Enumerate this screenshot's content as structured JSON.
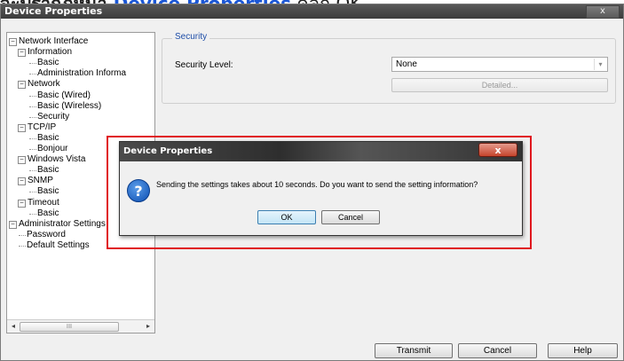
{
  "caption": {
    "prefix": "จะปรากฏหน้า ",
    "highlight": "Device Properties",
    "suffix": " คลิก OK"
  },
  "window": {
    "title": "Device Properties",
    "close_glyph": "x"
  },
  "tree": [
    {
      "label": "Network Interface",
      "level": 0,
      "expander": "−"
    },
    {
      "label": "Information",
      "level": 1,
      "expander": "−"
    },
    {
      "label": "Basic",
      "level": 2
    },
    {
      "label": "Administration Informa",
      "level": 2
    },
    {
      "label": "Network",
      "level": 1,
      "expander": "−"
    },
    {
      "label": "Basic (Wired)",
      "level": 2
    },
    {
      "label": "Basic (Wireless)",
      "level": 2
    },
    {
      "label": "Security",
      "level": 2,
      "selected": true
    },
    {
      "label": "TCP/IP",
      "level": 1,
      "expander": "−"
    },
    {
      "label": "Basic",
      "level": 2
    },
    {
      "label": "Bonjour",
      "level": 2
    },
    {
      "label": "Windows Vista",
      "level": 1,
      "expander": "−"
    },
    {
      "label": "Basic",
      "level": 2
    },
    {
      "label": "SNMP",
      "level": 1,
      "expander": "−"
    },
    {
      "label": "Basic",
      "level": 2
    },
    {
      "label": "Timeout",
      "level": 1,
      "expander": "−"
    },
    {
      "label": "Basic",
      "level": 2
    },
    {
      "label": "Administrator Settings",
      "level": 0,
      "expander": "−"
    },
    {
      "label": "Password",
      "level": 1
    },
    {
      "label": "Default Settings",
      "level": 1
    }
  ],
  "scroll": {
    "left": "◂",
    "right": "▸",
    "grip": "III"
  },
  "security": {
    "group_label": "Security",
    "level_label": "Security Level:",
    "level_value": "None",
    "dropdown_glyph": "▾",
    "detailed_label": "Detailed..."
  },
  "bottom_buttons": {
    "transmit": "Transmit",
    "cancel": "Cancel",
    "help": "Help"
  },
  "dialog": {
    "title": "Device Properties",
    "close_glyph": "x",
    "icon_glyph": "?",
    "message": "Sending the settings takes about 10 seconds. Do you want to send the setting information?",
    "ok": "OK",
    "cancel": "Cancel"
  },
  "colors": {
    "highlight_border": "#e0161e",
    "caption_link": "#1a56d6",
    "group_label": "#1f4ea8"
  }
}
